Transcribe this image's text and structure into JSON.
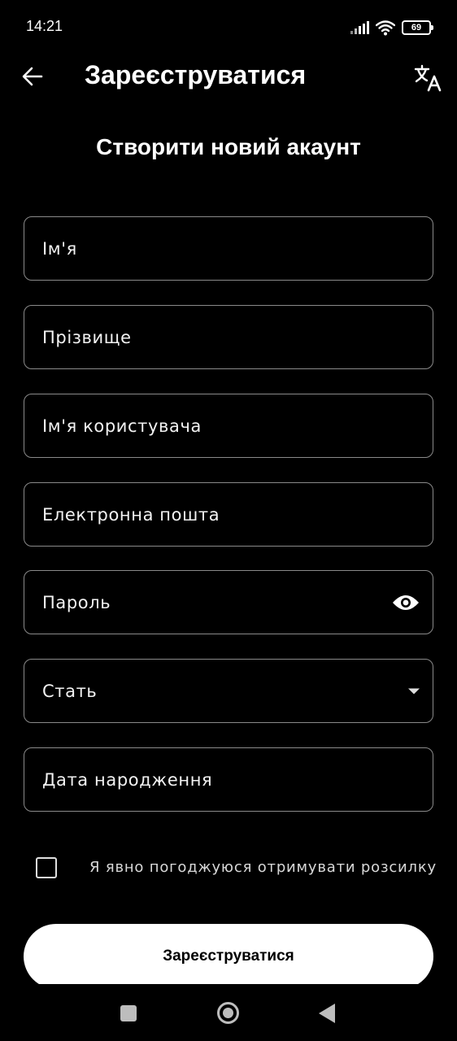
{
  "status_bar": {
    "time": "14:21",
    "battery": "69",
    "icons": [
      "signal-icon",
      "wifi-icon",
      "battery-icon"
    ]
  },
  "app_bar": {
    "title": "Зареєструватися",
    "back_icon": "arrow-left-icon",
    "translate_icon": "translate-icon"
  },
  "heading": "Створити новий акаунт",
  "form": {
    "first_name": {
      "placeholder": "Ім'я",
      "value": ""
    },
    "last_name": {
      "placeholder": "Прізвище",
      "value": ""
    },
    "username": {
      "placeholder": "Ім'я користувача",
      "value": ""
    },
    "email": {
      "placeholder": "Електронна пошта",
      "value": ""
    },
    "password": {
      "placeholder": "Пароль",
      "value": "",
      "toggle_icon": "eye-icon"
    },
    "gender": {
      "selected": "Стать",
      "icon": "dropdown-arrow-icon"
    },
    "birth_date": {
      "placeholder": "Дата народження",
      "value": ""
    }
  },
  "newsletter": {
    "label": "Я явно погоджуюся отримувати розсилку",
    "checked": false
  },
  "submit_label": "Зареєструватися",
  "nav_bar": {
    "icons": [
      "recent-apps-icon",
      "home-icon",
      "back-icon"
    ]
  },
  "colors": {
    "background": "#000000",
    "text": "#ffffff",
    "field_border": "#8a8a8a",
    "button_bg": "#ffffff",
    "button_text": "#000000"
  }
}
